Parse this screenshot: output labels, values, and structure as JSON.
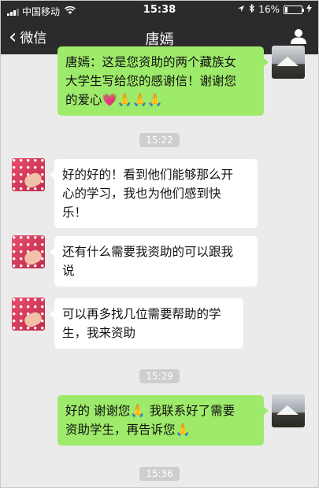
{
  "status_bar": {
    "carrier": "中国移动",
    "time": "15:38",
    "battery_percent": "16%",
    "battery_level": 0.16,
    "icons": [
      "signal-icon",
      "wifi-icon",
      "location-icon",
      "bluetooth-icon",
      "battery-icon",
      "charging-icon"
    ]
  },
  "nav": {
    "back_label": "微信",
    "title": "唐嫣",
    "profile_icon": "person-icon"
  },
  "messages": [
    {
      "sender": "self",
      "lines": [
        "唐嫣：这是您资助的两个藏族女",
        "大学生写给您的感谢信！谢谢您",
        "的爱心💗🙏🙏🙏"
      ]
    },
    {
      "timestamp": "15:22"
    },
    {
      "sender": "other",
      "lines": [
        "好的好的！看到他们能够那么开",
        "心的学习，我也为他们感到快",
        "乐！"
      ]
    },
    {
      "sender": "other",
      "lines": [
        "还有什么需要我资助的可以跟我",
        "说"
      ]
    },
    {
      "sender": "other",
      "lines": [
        "可以再多找几位需要帮助的学",
        "生，我来资助"
      ]
    },
    {
      "timestamp": "15:29"
    },
    {
      "sender": "self",
      "lines": [
        "好的 谢谢您🙏 我联系好了需要",
        "资助学生，再告诉您🙏"
      ]
    },
    {
      "timestamp": "15:36"
    }
  ],
  "colors": {
    "header_bg": "#2b2b2d",
    "chat_bg": "#ebebeb",
    "self_bubble": "#9eea6a",
    "other_bubble": "#ffffff",
    "timestamp_bg": "#cecece"
  }
}
